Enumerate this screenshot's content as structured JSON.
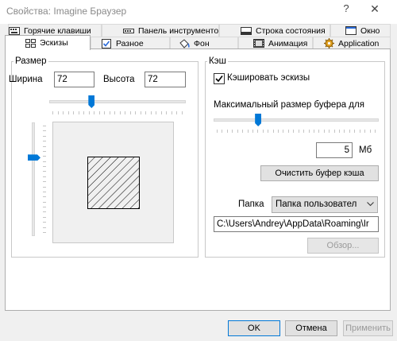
{
  "window": {
    "title": "Свойства: Imagine Браузер",
    "help_label": "?",
    "close_label": "✕"
  },
  "tabs_top": [
    {
      "label": "Горячие клавиши",
      "icon": "keyboard-icon"
    },
    {
      "label": "Панель инструментов",
      "icon": "toolbar-icon"
    },
    {
      "label": "Строка состояния",
      "icon": "status-bar-icon"
    },
    {
      "label": "Окно",
      "icon": "window-icon"
    }
  ],
  "tabs_bottom": [
    {
      "label": "Эскизы",
      "icon": "thumbnails-icon",
      "active": true
    },
    {
      "label": "Разное",
      "icon": "checkbox-icon"
    },
    {
      "label": "Фон",
      "icon": "paint-bucket-icon"
    },
    {
      "label": "Анимация",
      "icon": "film-icon"
    },
    {
      "label": "Application",
      "icon": "gear-icon"
    }
  ],
  "size_group": {
    "title": "Размер",
    "width_label": "Ширина",
    "width_value": "72",
    "height_label": "Высота",
    "height_value": "72",
    "h_slider_level": 0.31,
    "v_slider_level": 0.31
  },
  "cache_group": {
    "title": "Кэш",
    "cache_checkbox_label": "Кэшировать эскизы",
    "cache_checked": true,
    "max_buffer_label": "Максимальный размер буфера для",
    "buffer_slider_level": 0.27,
    "buffer_value": "5",
    "buffer_unit": "Мб",
    "clear_button": "Очистить буфер кэша",
    "folder_label": "Папка",
    "folder_select": "Папка пользовател",
    "path_value": "C:\\Users\\Andrey\\AppData\\Roaming\\Ir",
    "browse_button": "Обзор..."
  },
  "buttons": {
    "ok": "OK",
    "cancel": "Отмена",
    "apply": "Применить"
  },
  "colors": {
    "accent": "#0078d7",
    "disabled_text": "#9a9a9a"
  }
}
